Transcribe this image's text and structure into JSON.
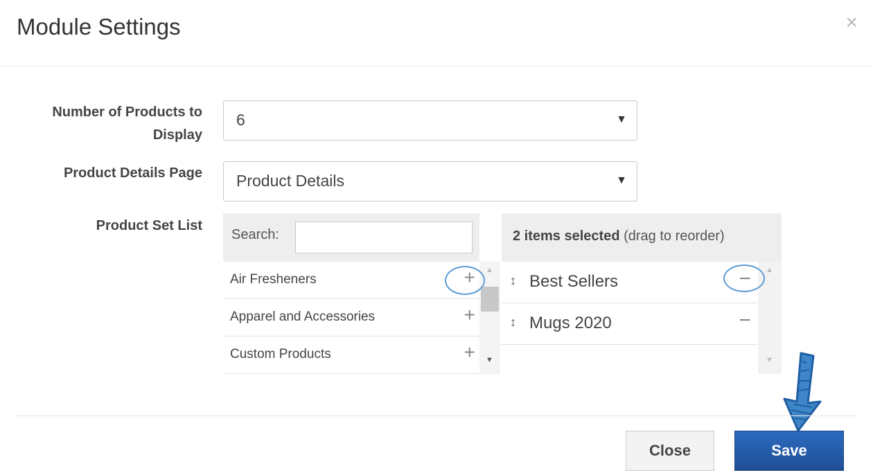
{
  "header": {
    "title": "Module Settings",
    "close_symbol": "×"
  },
  "fields": {
    "num_products": {
      "label_line1": "Number of Products to",
      "label_line2": "Display",
      "value": "6"
    },
    "details_page": {
      "label": "Product Details Page",
      "value": "Product Details"
    },
    "product_set": {
      "label": "Product Set List"
    }
  },
  "available": {
    "search_label": "Search:",
    "search_value": "",
    "items": [
      {
        "name": "Air Fresheners"
      },
      {
        "name": "Apparel and Accessories"
      },
      {
        "name": "Custom Products"
      }
    ],
    "add_symbol": "+"
  },
  "selected": {
    "count_text": "2 items selected",
    "hint_text": "(drag to reorder)",
    "items": [
      {
        "name": "Best Sellers"
      },
      {
        "name": "Mugs 2020"
      }
    ],
    "drag_symbol": "↕",
    "remove_symbol": "−"
  },
  "footer": {
    "close_label": "Close",
    "save_label": "Save"
  },
  "colors": {
    "save_button": "#2660ad",
    "annotation": "#5b9bd5"
  }
}
